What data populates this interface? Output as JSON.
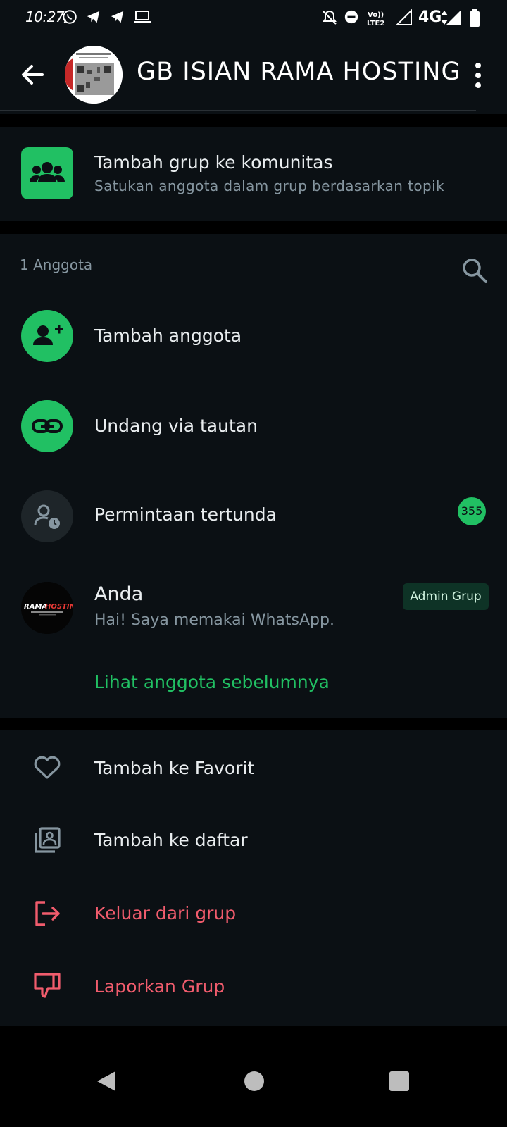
{
  "status_bar": {
    "time": "10:27",
    "network": "4G",
    "volte": "Vo)) LTE2",
    "notification_icons": [
      "whatsapp-icon",
      "telegram-icon",
      "telegram-icon",
      "laptop-icon"
    ],
    "system_icons": [
      "mute-icon",
      "do-not-disturb-icon",
      "volte-icon",
      "signal-icon",
      "data-icon",
      "battery-icon"
    ]
  },
  "header": {
    "group_name": "GB ISIAN RAMA HOSTING",
    "back_icon": "arrow-back-icon",
    "menu_icon": "more-vert-icon"
  },
  "community": {
    "title": "Tambah grup ke komunitas",
    "subtitle": "Satukan anggota dalam grup berdasarkan topik",
    "icon": "community-icon"
  },
  "members": {
    "count_label": "1 Anggota",
    "add_member_label": "Tambah anggota",
    "invite_link_label": "Undang via tautan",
    "pending_label": "Permintaan tertunda",
    "pending_count": "355",
    "member": {
      "name": "Anda",
      "status": "Hai! Saya memakai WhatsApp.",
      "role_badge": "Admin Grup",
      "avatar_text": "RAMA HOSTING"
    },
    "view_previous_label": "Lihat anggota sebelumnya"
  },
  "actions": [
    {
      "label": "Tambah ke Favorit",
      "icon": "heart-icon",
      "danger": false
    },
    {
      "label": "Tambah ke daftar",
      "icon": "list-add-icon",
      "danger": false
    },
    {
      "label": "Keluar dari grup",
      "icon": "exit-icon",
      "danger": true
    },
    {
      "label": "Laporkan Grup",
      "icon": "thumbs-down-icon",
      "danger": true
    }
  ],
  "nav_bar": {
    "back": "nav-back-icon",
    "home": "nav-home-icon",
    "recents": "nav-recents-icon"
  },
  "colors": {
    "background": "#0b1014",
    "accent": "#21c063",
    "danger": "#f15c6d",
    "text_primary": "#e9edef",
    "text_secondary": "#8696a0"
  }
}
